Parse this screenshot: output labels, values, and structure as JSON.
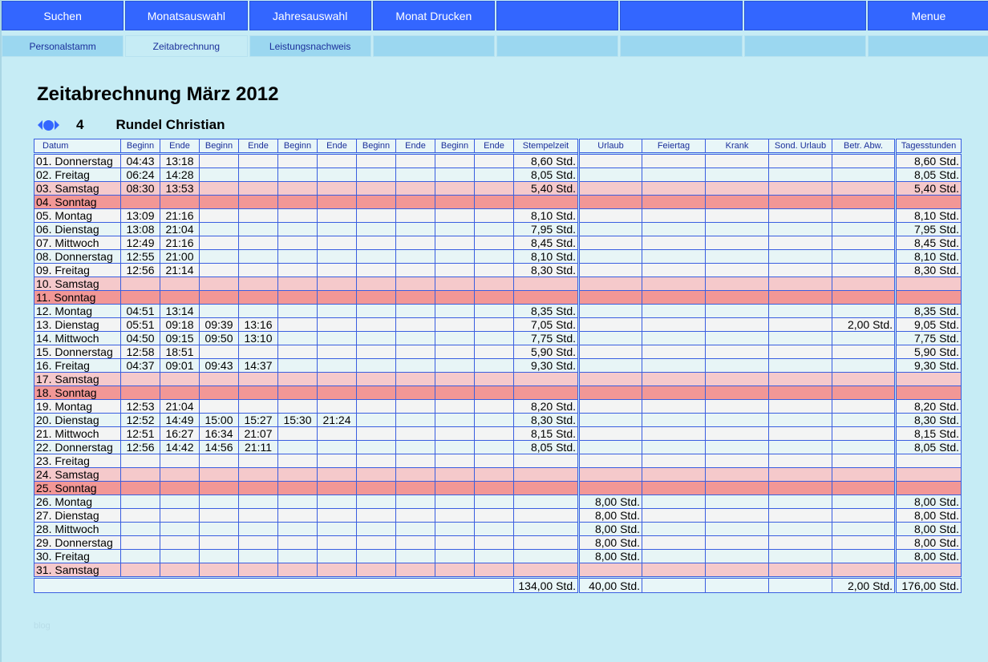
{
  "nav_primary": [
    "Suchen",
    "Monatsauswahl",
    "Jahresauswahl",
    "Monat Drucken",
    "",
    "",
    "",
    "Menue"
  ],
  "nav_secondary": [
    "Personalstamm",
    "Zeitabrechnung",
    "Leistungsnachweis",
    "",
    "",
    "",
    "",
    ""
  ],
  "active_tab": "Zeitabrechnung",
  "title": "Zeitabrechnung März 2012",
  "employee": {
    "number": "4",
    "name": "Rundel Christian"
  },
  "footer_text": "blog",
  "colors": {
    "nav": "#3366ff",
    "tab": "#9bd7f0",
    "background": "#c6ecf5",
    "saturday": "#f5c9cb",
    "sunday": "#f29796",
    "grid": "#3a5ee0"
  },
  "columns": [
    "Datum",
    "Beginn",
    "Ende",
    "Beginn",
    "Ende",
    "Beginn",
    "Ende",
    "Beginn",
    "Ende",
    "Beginn",
    "Ende",
    "Stempelzeit",
    "Urlaub",
    "Feiertag",
    "Krank",
    "Sond. Urlaub",
    "Betr. Abw.",
    "Tagesstunden"
  ],
  "rows": [
    {
      "type": "weekday",
      "datum": "01. Donnerstag",
      "times": [
        "04:43",
        "13:18",
        "",
        "",
        "",
        "",
        "",
        "",
        "",
        ""
      ],
      "stempelzeit": "8,60 Std.",
      "urlaub": "",
      "feiertag": "",
      "krank": "",
      "sond_urlaub": "",
      "betr_abw": "",
      "tagesstunden": "8,60 Std."
    },
    {
      "type": "weekday",
      "datum": "02. Freitag",
      "times": [
        "06:24",
        "14:28",
        "",
        "",
        "",
        "",
        "",
        "",
        "",
        ""
      ],
      "stempelzeit": "8,05 Std.",
      "urlaub": "",
      "feiertag": "",
      "krank": "",
      "sond_urlaub": "",
      "betr_abw": "",
      "tagesstunden": "8,05 Std."
    },
    {
      "type": "sat",
      "datum": "03. Samstag",
      "times": [
        "08:30",
        "13:53",
        "",
        "",
        "",
        "",
        "",
        "",
        "",
        ""
      ],
      "stempelzeit": "5,40 Std.",
      "urlaub": "",
      "feiertag": "",
      "krank": "",
      "sond_urlaub": "",
      "betr_abw": "",
      "tagesstunden": "5,40 Std."
    },
    {
      "type": "sun",
      "datum": "04. Sonntag",
      "times": [
        "",
        "",
        "",
        "",
        "",
        "",
        "",
        "",
        "",
        ""
      ],
      "stempelzeit": "",
      "urlaub": "",
      "feiertag": "",
      "krank": "",
      "sond_urlaub": "",
      "betr_abw": "",
      "tagesstunden": ""
    },
    {
      "type": "weekday",
      "datum": "05. Montag",
      "times": [
        "13:09",
        "21:16",
        "",
        "",
        "",
        "",
        "",
        "",
        "",
        ""
      ],
      "stempelzeit": "8,10 Std.",
      "urlaub": "",
      "feiertag": "",
      "krank": "",
      "sond_urlaub": "",
      "betr_abw": "",
      "tagesstunden": "8,10 Std."
    },
    {
      "type": "weekday",
      "datum": "06. Dienstag",
      "times": [
        "13:08",
        "21:04",
        "",
        "",
        "",
        "",
        "",
        "",
        "",
        ""
      ],
      "stempelzeit": "7,95 Std.",
      "urlaub": "",
      "feiertag": "",
      "krank": "",
      "sond_urlaub": "",
      "betr_abw": "",
      "tagesstunden": "7,95 Std."
    },
    {
      "type": "weekday",
      "datum": "07. Mittwoch",
      "times": [
        "12:49",
        "21:16",
        "",
        "",
        "",
        "",
        "",
        "",
        "",
        ""
      ],
      "stempelzeit": "8,45 Std.",
      "urlaub": "",
      "feiertag": "",
      "krank": "",
      "sond_urlaub": "",
      "betr_abw": "",
      "tagesstunden": "8,45 Std."
    },
    {
      "type": "weekday",
      "datum": "08. Donnerstag",
      "times": [
        "12:55",
        "21:00",
        "",
        "",
        "",
        "",
        "",
        "",
        "",
        ""
      ],
      "stempelzeit": "8,10 Std.",
      "urlaub": "",
      "feiertag": "",
      "krank": "",
      "sond_urlaub": "",
      "betr_abw": "",
      "tagesstunden": "8,10 Std."
    },
    {
      "type": "weekday",
      "datum": "09. Freitag",
      "times": [
        "12:56",
        "21:14",
        "",
        "",
        "",
        "",
        "",
        "",
        "",
        ""
      ],
      "stempelzeit": "8,30 Std.",
      "urlaub": "",
      "feiertag": "",
      "krank": "",
      "sond_urlaub": "",
      "betr_abw": "",
      "tagesstunden": "8,30 Std."
    },
    {
      "type": "sat",
      "datum": "10. Samstag",
      "times": [
        "",
        "",
        "",
        "",
        "",
        "",
        "",
        "",
        "",
        ""
      ],
      "stempelzeit": "",
      "urlaub": "",
      "feiertag": "",
      "krank": "",
      "sond_urlaub": "",
      "betr_abw": "",
      "tagesstunden": ""
    },
    {
      "type": "sun",
      "datum": "11. Sonntag",
      "times": [
        "",
        "",
        "",
        "",
        "",
        "",
        "",
        "",
        "",
        ""
      ],
      "stempelzeit": "",
      "urlaub": "",
      "feiertag": "",
      "krank": "",
      "sond_urlaub": "",
      "betr_abw": "",
      "tagesstunden": ""
    },
    {
      "type": "weekday",
      "datum": "12. Montag",
      "times": [
        "04:51",
        "13:14",
        "",
        "",
        "",
        "",
        "",
        "",
        "",
        ""
      ],
      "stempelzeit": "8,35 Std.",
      "urlaub": "",
      "feiertag": "",
      "krank": "",
      "sond_urlaub": "",
      "betr_abw": "",
      "tagesstunden": "8,35 Std."
    },
    {
      "type": "weekday",
      "datum": "13. Dienstag",
      "times": [
        "05:51",
        "09:18",
        "09:39",
        "13:16",
        "",
        "",
        "",
        "",
        "",
        ""
      ],
      "stempelzeit": "7,05 Std.",
      "urlaub": "",
      "feiertag": "",
      "krank": "",
      "sond_urlaub": "",
      "betr_abw": "2,00 Std.",
      "tagesstunden": "9,05 Std."
    },
    {
      "type": "weekday",
      "datum": "14. Mittwoch",
      "times": [
        "04:50",
        "09:15",
        "09:50",
        "13:10",
        "",
        "",
        "",
        "",
        "",
        ""
      ],
      "stempelzeit": "7,75 Std.",
      "urlaub": "",
      "feiertag": "",
      "krank": "",
      "sond_urlaub": "",
      "betr_abw": "",
      "tagesstunden": "7,75 Std."
    },
    {
      "type": "weekday",
      "datum": "15. Donnerstag",
      "times": [
        "12:58",
        "18:51",
        "",
        "",
        "",
        "",
        "",
        "",
        "",
        ""
      ],
      "stempelzeit": "5,90 Std.",
      "urlaub": "",
      "feiertag": "",
      "krank": "",
      "sond_urlaub": "",
      "betr_abw": "",
      "tagesstunden": "5,90 Std."
    },
    {
      "type": "weekday",
      "datum": "16. Freitag",
      "times": [
        "04:37",
        "09:01",
        "09:43",
        "14:37",
        "",
        "",
        "",
        "",
        "",
        ""
      ],
      "stempelzeit": "9,30 Std.",
      "urlaub": "",
      "feiertag": "",
      "krank": "",
      "sond_urlaub": "",
      "betr_abw": "",
      "tagesstunden": "9,30 Std."
    },
    {
      "type": "sat",
      "datum": "17. Samstag",
      "times": [
        "",
        "",
        "",
        "",
        "",
        "",
        "",
        "",
        "",
        ""
      ],
      "stempelzeit": "",
      "urlaub": "",
      "feiertag": "",
      "krank": "",
      "sond_urlaub": "",
      "betr_abw": "",
      "tagesstunden": ""
    },
    {
      "type": "sun",
      "datum": "18. Sonntag",
      "times": [
        "",
        "",
        "",
        "",
        "",
        "",
        "",
        "",
        "",
        ""
      ],
      "stempelzeit": "",
      "urlaub": "",
      "feiertag": "",
      "krank": "",
      "sond_urlaub": "",
      "betr_abw": "",
      "tagesstunden": ""
    },
    {
      "type": "weekday",
      "datum": "19. Montag",
      "times": [
        "12:53",
        "21:04",
        "",
        "",
        "",
        "",
        "",
        "",
        "",
        ""
      ],
      "stempelzeit": "8,20 Std.",
      "urlaub": "",
      "feiertag": "",
      "krank": "",
      "sond_urlaub": "",
      "betr_abw": "",
      "tagesstunden": "8,20 Std."
    },
    {
      "type": "weekday",
      "datum": "20. Dienstag",
      "times": [
        "12:52",
        "14:49",
        "15:00",
        "15:27",
        "15:30",
        "21:24",
        "",
        "",
        "",
        ""
      ],
      "stempelzeit": "8,30 Std.",
      "urlaub": "",
      "feiertag": "",
      "krank": "",
      "sond_urlaub": "",
      "betr_abw": "",
      "tagesstunden": "8,30 Std."
    },
    {
      "type": "weekday",
      "datum": "21. Mittwoch",
      "times": [
        "12:51",
        "16:27",
        "16:34",
        "21:07",
        "",
        "",
        "",
        "",
        "",
        ""
      ],
      "stempelzeit": "8,15 Std.",
      "urlaub": "",
      "feiertag": "",
      "krank": "",
      "sond_urlaub": "",
      "betr_abw": "",
      "tagesstunden": "8,15 Std."
    },
    {
      "type": "weekday",
      "datum": "22. Donnerstag",
      "times": [
        "12:56",
        "14:42",
        "14:56",
        "21:11",
        "",
        "",
        "",
        "",
        "",
        ""
      ],
      "stempelzeit": "8,05 Std.",
      "urlaub": "",
      "feiertag": "",
      "krank": "",
      "sond_urlaub": "",
      "betr_abw": "",
      "tagesstunden": "8,05 Std."
    },
    {
      "type": "weekday",
      "datum": "23. Freitag",
      "times": [
        "",
        "",
        "",
        "",
        "",
        "",
        "",
        "",
        "",
        ""
      ],
      "stempelzeit": "",
      "urlaub": "",
      "feiertag": "",
      "krank": "",
      "sond_urlaub": "",
      "betr_abw": "",
      "tagesstunden": ""
    },
    {
      "type": "sat",
      "datum": "24. Samstag",
      "times": [
        "",
        "",
        "",
        "",
        "",
        "",
        "",
        "",
        "",
        ""
      ],
      "stempelzeit": "",
      "urlaub": "",
      "feiertag": "",
      "krank": "",
      "sond_urlaub": "",
      "betr_abw": "",
      "tagesstunden": ""
    },
    {
      "type": "sun",
      "datum": "25. Sonntag",
      "times": [
        "",
        "",
        "",
        "",
        "",
        "",
        "",
        "",
        "",
        ""
      ],
      "stempelzeit": "",
      "urlaub": "",
      "feiertag": "",
      "krank": "",
      "sond_urlaub": "",
      "betr_abw": "",
      "tagesstunden": ""
    },
    {
      "type": "weekday",
      "datum": "26. Montag",
      "times": [
        "",
        "",
        "",
        "",
        "",
        "",
        "",
        "",
        "",
        ""
      ],
      "stempelzeit": "",
      "urlaub": "8,00 Std.",
      "feiertag": "",
      "krank": "",
      "sond_urlaub": "",
      "betr_abw": "",
      "tagesstunden": "8,00 Std."
    },
    {
      "type": "weekday",
      "datum": "27. Dienstag",
      "times": [
        "",
        "",
        "",
        "",
        "",
        "",
        "",
        "",
        "",
        ""
      ],
      "stempelzeit": "",
      "urlaub": "8,00 Std.",
      "feiertag": "",
      "krank": "",
      "sond_urlaub": "",
      "betr_abw": "",
      "tagesstunden": "8,00 Std."
    },
    {
      "type": "weekday",
      "datum": "28. Mittwoch",
      "times": [
        "",
        "",
        "",
        "",
        "",
        "",
        "",
        "",
        "",
        ""
      ],
      "stempelzeit": "",
      "urlaub": "8,00 Std.",
      "feiertag": "",
      "krank": "",
      "sond_urlaub": "",
      "betr_abw": "",
      "tagesstunden": "8,00 Std."
    },
    {
      "type": "weekday",
      "datum": "29. Donnerstag",
      "times": [
        "",
        "",
        "",
        "",
        "",
        "",
        "",
        "",
        "",
        ""
      ],
      "stempelzeit": "",
      "urlaub": "8,00 Std.",
      "feiertag": "",
      "krank": "",
      "sond_urlaub": "",
      "betr_abw": "",
      "tagesstunden": "8,00 Std."
    },
    {
      "type": "weekday",
      "datum": "30. Freitag",
      "times": [
        "",
        "",
        "",
        "",
        "",
        "",
        "",
        "",
        "",
        ""
      ],
      "stempelzeit": "",
      "urlaub": "8,00 Std.",
      "feiertag": "",
      "krank": "",
      "sond_urlaub": "",
      "betr_abw": "",
      "tagesstunden": "8,00 Std."
    },
    {
      "type": "sat",
      "datum": "31. Samstag",
      "times": [
        "",
        "",
        "",
        "",
        "",
        "",
        "",
        "",
        "",
        ""
      ],
      "stempelzeit": "",
      "urlaub": "",
      "feiertag": "",
      "krank": "",
      "sond_urlaub": "",
      "betr_abw": "",
      "tagesstunden": ""
    }
  ],
  "totals": {
    "stempelzeit": "134,00 Std.",
    "urlaub": "40,00 Std.",
    "feiertag": "",
    "krank": "",
    "sond_urlaub": "",
    "betr_abw": "2,00 Std.",
    "tagesstunden": "176,00 Std."
  }
}
